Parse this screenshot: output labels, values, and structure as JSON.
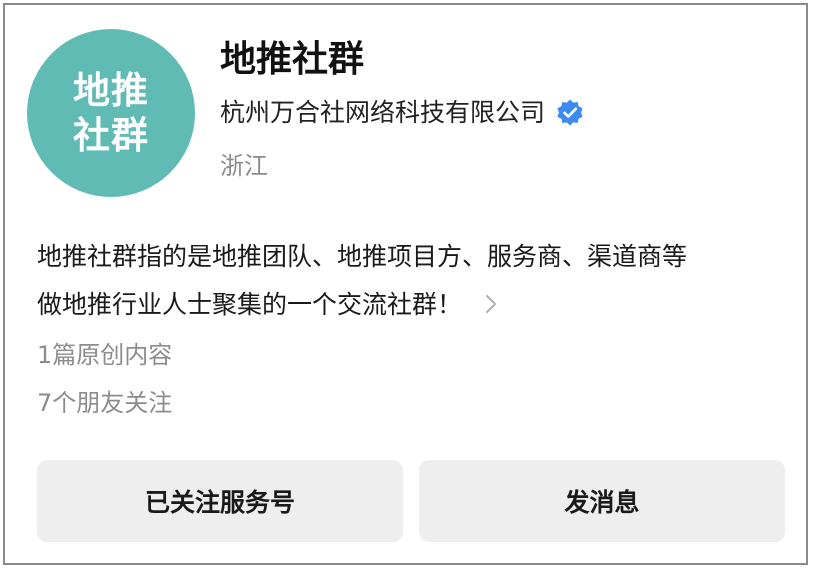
{
  "profile": {
    "avatar_text_line1": "地推",
    "avatar_text_line2": "社群",
    "avatar_color": "#5fbbb4",
    "name": "地推社群",
    "company": "杭州万合社网络科技有限公司",
    "verified_icon": "verified-badge-icon",
    "verified_color": "#3d8bf2",
    "region": "浙江"
  },
  "description": {
    "line1": "地推社群指的是地推团队、地推项目方、服务商、渠道商等",
    "line2": "做地推行业人士聚集的一个交流社群！",
    "more_icon": "chevron-right-icon"
  },
  "stats": {
    "articles": "1篇原创内容",
    "friends": "7个朋友关注"
  },
  "actions": {
    "follow_label": "已关注服务号",
    "message_label": "发消息"
  }
}
